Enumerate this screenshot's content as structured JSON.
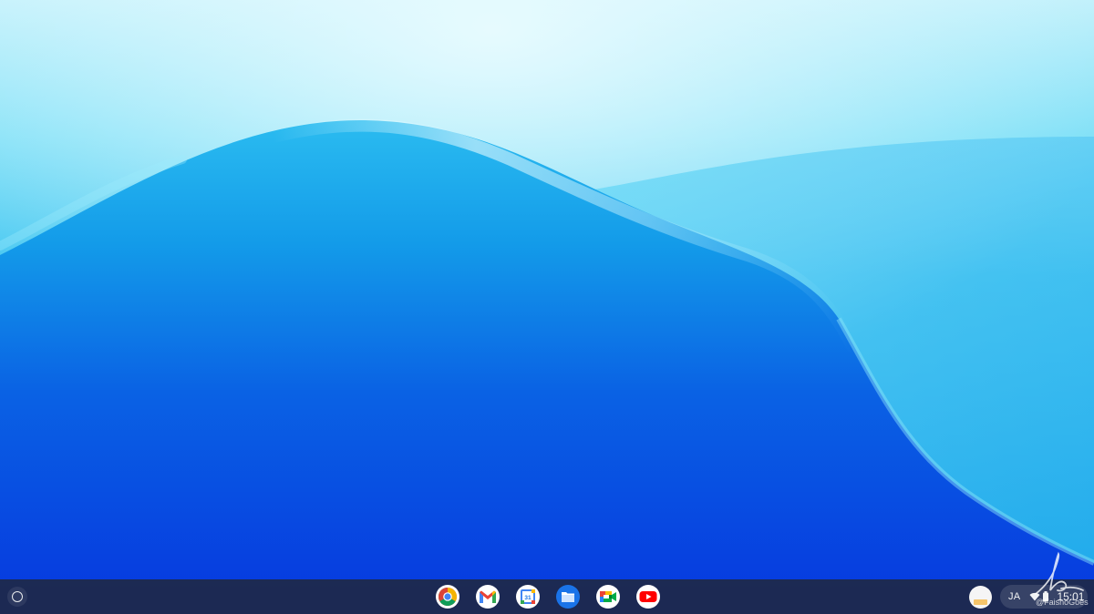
{
  "desktop": {
    "wallpaper": {
      "colors": {
        "top_light": "#c8f3fb",
        "mid": "#4fd0f2",
        "deep": "#0a4fe2",
        "bottom": "#0635df"
      }
    }
  },
  "shelf": {
    "launcher_icon": "launcher-circle-icon",
    "pinned_apps": [
      {
        "name": "Chrome",
        "icon": "chrome-icon"
      },
      {
        "name": "Gmail",
        "icon": "gmail-icon"
      },
      {
        "name": "Calendar",
        "icon": "calendar-icon",
        "badge": "31"
      },
      {
        "name": "Files",
        "icon": "files-icon"
      },
      {
        "name": "Meet",
        "icon": "meet-icon"
      },
      {
        "name": "YouTube",
        "icon": "youtube-icon"
      }
    ],
    "holding_space_icon": "holding-space-icon",
    "status_area": {
      "ime": "JA",
      "icons": [
        "wifi-icon",
        "battery-icon"
      ],
      "time": "15:01"
    }
  },
  "watermark": {
    "handle": "@FaishoGoes"
  }
}
